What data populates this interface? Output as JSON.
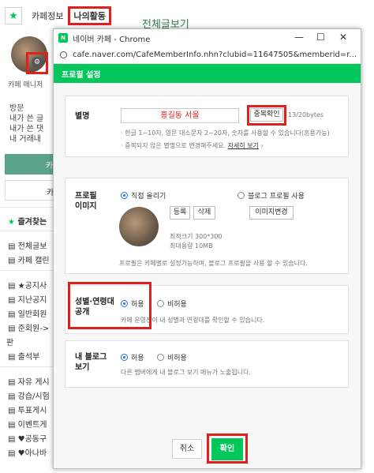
{
  "background": {
    "tabs": [
      "카페정보",
      "나의활동"
    ],
    "page_title": "전체글보기",
    "manager_label": "카페 매니저",
    "stats": [
      "방문",
      "내가 쓴 글",
      "내가 쓴 댓",
      "내 거래내"
    ],
    "green_button": "카",
    "second_button": "카",
    "favorites_title": "즐겨찾는",
    "menu_top": [
      "전체글보",
      "카페 캘린"
    ],
    "menu_items": [
      "★공지사",
      "지난공지",
      "일반회원",
      "준회원->",
      "판",
      "출석부",
      "자유 게시",
      "강습/시험",
      "투표게시",
      "이벤트게",
      "♥공동구",
      "♥아나바"
    ]
  },
  "window": {
    "title": "네이버 카페 - Chrome",
    "url": "cafe.naver.com/CafeMemberInfo.nhn?clubid=11647505&memberid=r...",
    "header": "프로필 설정",
    "nickname": {
      "label": "별명",
      "value": "홍길동 서울",
      "check_button": "중복확인",
      "counter": "13/20bytes",
      "note1": "· 한글 1~10자, 영문 대소문자 2~20자, 숫자를 사용할 수 있습니다(혼용가능)",
      "note2": "· 중복되지 않은 별명으로 변경해주세요.",
      "note2_link": "자세히 보기",
      "note2_end": " ›"
    },
    "profile_image": {
      "label_line1": "프로필",
      "label_line2": "이미지",
      "option_direct": "직접 올리기",
      "option_blog": "블로그 프로필 사용",
      "register_button": "등록",
      "delete_button": "삭제",
      "change_button": "이미지변경",
      "size_min": "최적크기 300*300",
      "size_max": "최대용량 10MB",
      "note": "프로필은 카페별로 설정가능하며, 블로그 프로필을 사용 할 수 있습니다."
    },
    "gender_age": {
      "label_line1": "성별·연령대",
      "label_line2": "공개",
      "option_allow": "허용",
      "option_deny": "비허용",
      "note": "카페 운영진이 내 성별과 연령대를 확인할 수 있습니다."
    },
    "blog_view": {
      "label_line1": "내 블로그",
      "label_line2": "보기",
      "option_allow": "허용",
      "option_deny": "비허용",
      "note": "다른 멤버에게 내 블로그 보기 메뉴가 노출됩니다."
    },
    "cancel_button": "취소",
    "confirm_button": "확인"
  },
  "colors": {
    "naver_green": "#03c75a",
    "highlight_red": "#e0201f",
    "radio_blue": "#2b6de0"
  }
}
